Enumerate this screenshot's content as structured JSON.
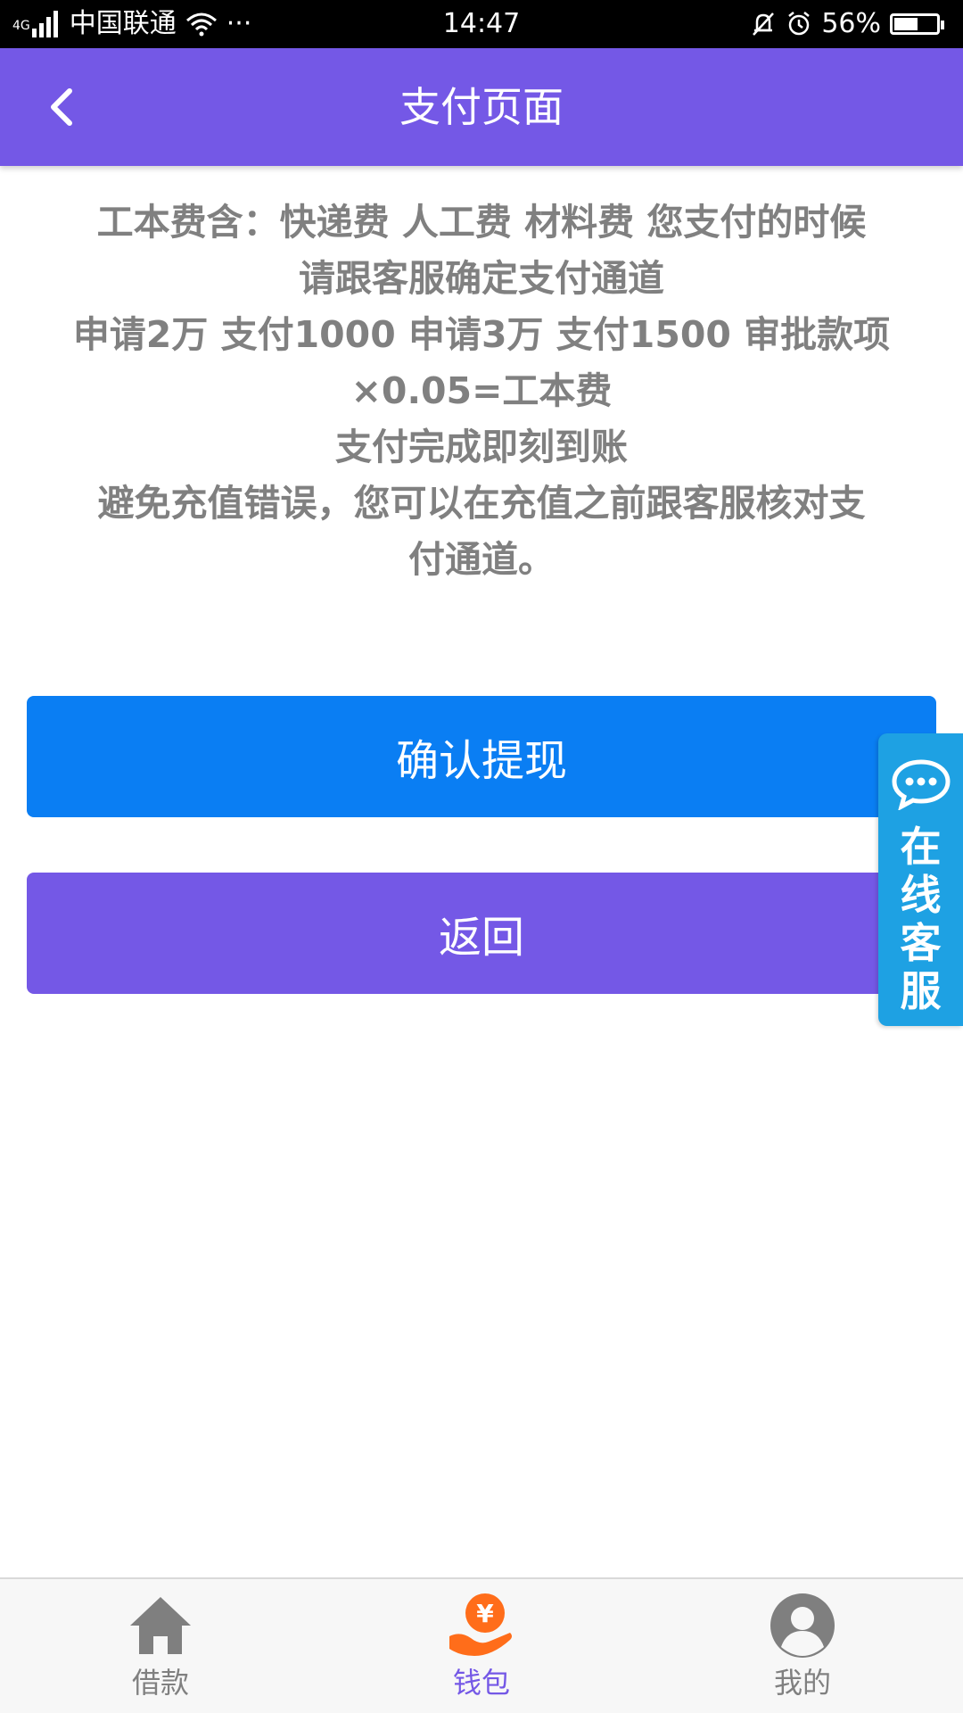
{
  "status_bar": {
    "network_type": "4G",
    "carrier": "中国联通",
    "more": "···",
    "time": "14:47",
    "battery_percent": "56%",
    "battery_level": 0.56
  },
  "header": {
    "title": "支付页面",
    "background_color": "#7458e6"
  },
  "notice": {
    "lines": [
      "工本费含：快递费 人工费 材料费 您支付的时候",
      "请跟客服确定支付通道",
      "申请2万 支付1000  申请3万 支付1500 审批款项",
      "×0.05=工本费",
      "支付完成即刻到账",
      "避免充值错误，您可以在充值之前跟客服核对支",
      "付通道。"
    ],
    "color": "#808080"
  },
  "buttons": {
    "confirm_label": "确认提现",
    "confirm_color": "#0a7ef3",
    "back_label": "返回",
    "back_color": "#7458e6"
  },
  "service_widget": {
    "chars": [
      "在",
      "线",
      "客",
      "服"
    ],
    "icon": "chat-bubble-icon",
    "color": "#1ea1e3"
  },
  "tab_bar": {
    "items": [
      {
        "label": "借款",
        "icon": "house-icon",
        "active": false
      },
      {
        "label": "钱包",
        "icon": "yuan-hand-icon",
        "active": true
      },
      {
        "label": "我的",
        "icon": "user-avatar-icon",
        "active": false
      }
    ],
    "active_label_color": "#7458e6",
    "inactive_color": "#808080"
  }
}
